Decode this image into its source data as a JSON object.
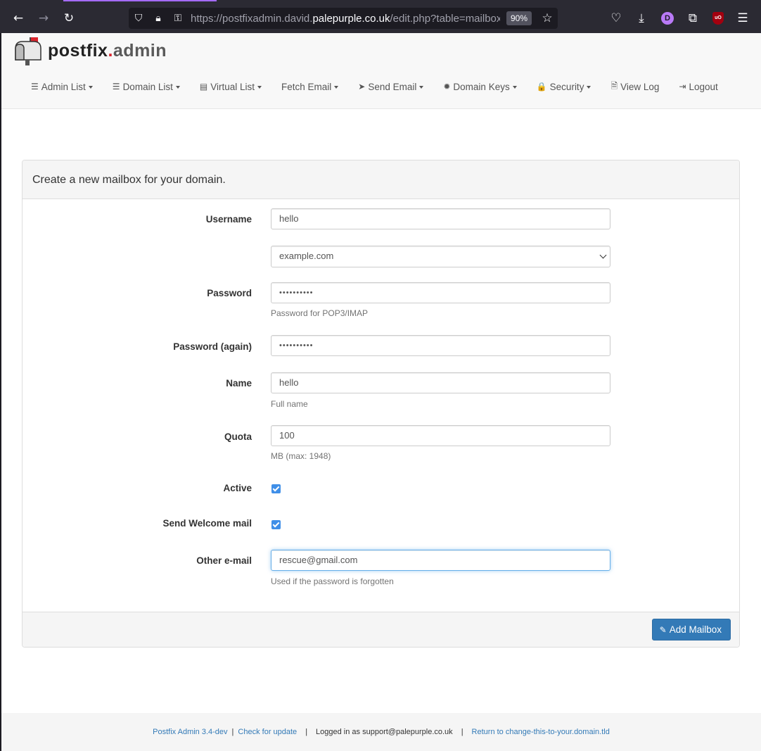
{
  "browser": {
    "url_prefix": "https://postfixadmin.david.",
    "url_host": "palepurple.co.uk",
    "url_suffix": "/edit.php?table=mailbox",
    "zoom": "90%",
    "account_initial": "D",
    "ublock_label": "uO"
  },
  "logo": {
    "part1": "postfix",
    "dot": ".",
    "part2": "admin"
  },
  "nav": {
    "items": [
      {
        "label": "Admin List",
        "icon": "list-icon",
        "glyph": "☰"
      },
      {
        "label": "Domain List",
        "icon": "list-icon",
        "glyph": "☰"
      },
      {
        "label": "Virtual List",
        "icon": "list-alt-icon",
        "glyph": "▤"
      },
      {
        "label": "Fetch Email",
        "icon": "",
        "glyph": ""
      },
      {
        "label": "Send Email",
        "icon": "send-icon",
        "glyph": "➤"
      },
      {
        "label": "Domain Keys",
        "icon": "cog-icon",
        "glyph": "✹"
      },
      {
        "label": "Security",
        "icon": "lock-icon",
        "glyph": "🔒"
      },
      {
        "label": "View Log",
        "icon": "file-icon",
        "glyph": "🗎"
      },
      {
        "label": "Logout",
        "icon": "logout-icon",
        "glyph": "⇥"
      }
    ]
  },
  "form": {
    "heading": "Create a new mailbox for your domain.",
    "username_label": "Username",
    "username_value": "hello",
    "domain_value": "example.com",
    "password_label": "Password",
    "password_value": "••••••••••",
    "password_help": "Password for POP3/IMAP",
    "password2_label": "Password (again)",
    "password2_value": "••••••••••",
    "name_label": "Name",
    "name_value": "hello",
    "name_help": "Full name",
    "quota_label": "Quota",
    "quota_value": "100",
    "quota_help": "MB (max: 1948)",
    "active_label": "Active",
    "welcome_label": "Send Welcome mail",
    "other_email_label": "Other e-mail",
    "other_email_value": "rescue@gmail.com",
    "other_email_help": "Used if the password is forgotten",
    "submit_label": "Add Mailbox"
  },
  "footer": {
    "version": "Postfix Admin 3.4-dev",
    "check_update": "Check for update",
    "logged_in": "Logged in as support@palepurple.co.uk",
    "return_link": "Return to change-this-to-your.domain.tld",
    "separator": "|"
  }
}
